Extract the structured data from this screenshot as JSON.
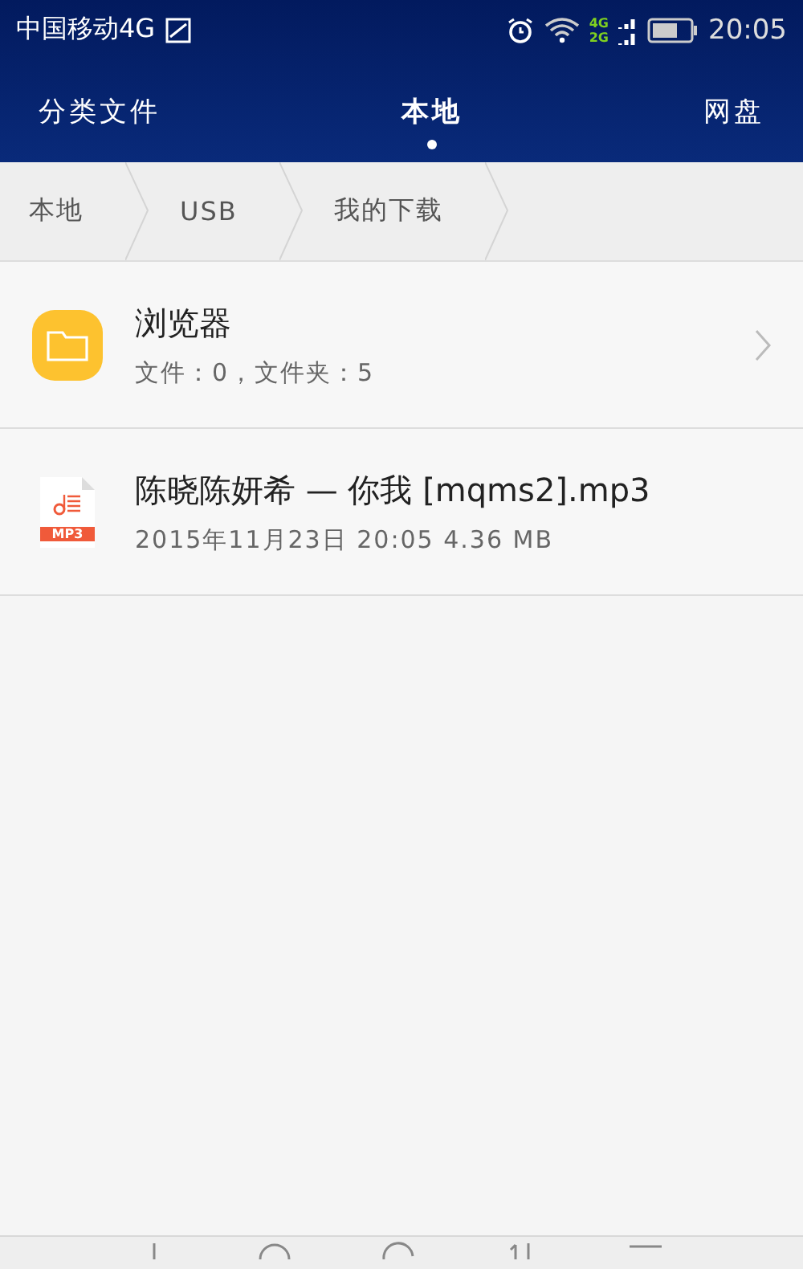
{
  "status_bar": {
    "carrier": "中国移动4G",
    "network_top": "4G",
    "network_bottom": "2G",
    "time": "20:05"
  },
  "tabs": [
    {
      "label": "分类文件",
      "selected": false
    },
    {
      "label": "本地",
      "selected": true
    },
    {
      "label": "网盘",
      "selected": false
    }
  ],
  "breadcrumb": [
    "本地",
    "USB",
    "我的下载"
  ],
  "files": [
    {
      "kind": "folder",
      "name": "浏览器",
      "details": "文件：0，文件夹：5"
    },
    {
      "kind": "mp3",
      "name": "陈晓陈妍希 — 你我 [mqms2].mp3",
      "details": "2015年11月23日 20:05 4.36 MB",
      "badge": "MP3"
    }
  ]
}
